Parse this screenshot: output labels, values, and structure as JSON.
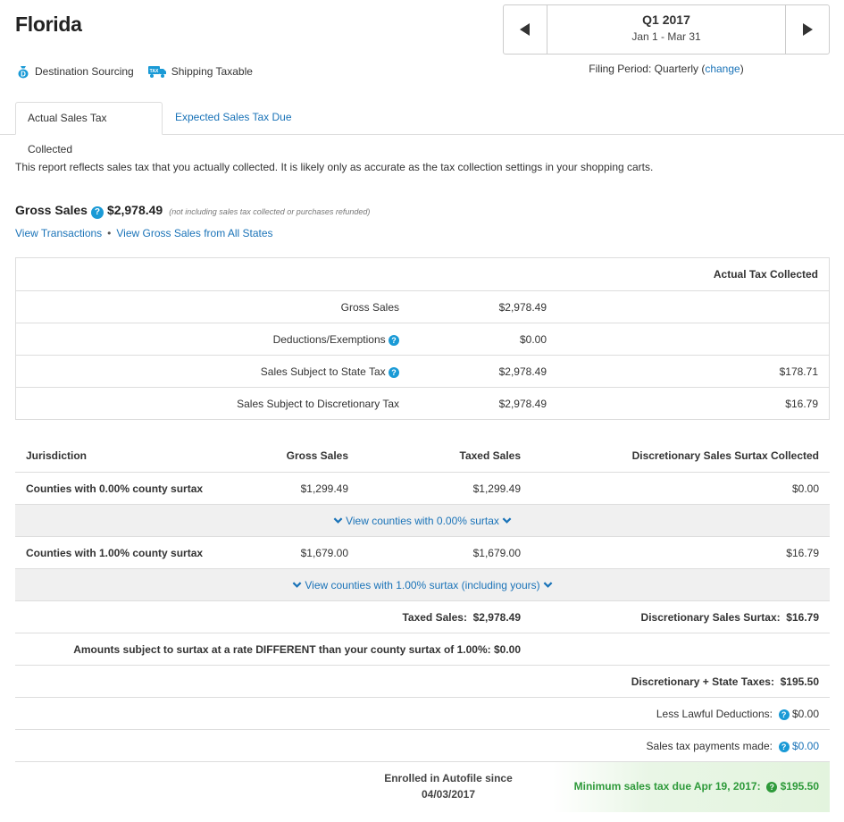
{
  "header": {
    "state": "Florida",
    "badges": [
      {
        "icon": "money-bag-icon",
        "label": "Destination Sourcing"
      },
      {
        "icon": "tax-truck-icon",
        "label": "Shipping Taxable"
      }
    ]
  },
  "period": {
    "quarter": "Q1 2017",
    "dates": "Jan 1 - Mar 31",
    "filing_prefix": "Filing Period: Quarterly (",
    "filing_change": "change",
    "filing_suffix": ")"
  },
  "tabs": [
    {
      "label": "Actual Sales Tax Collected",
      "active": true
    },
    {
      "label": "Expected Sales Tax Due",
      "active": false
    }
  ],
  "intro": "This report reflects sales tax that you actually collected. It is likely only as accurate as the tax collection settings in your shopping carts.",
  "gross": {
    "label": "Gross Sales",
    "value": "$2,978.49",
    "note": "(not including sales tax collected or purchases refunded)",
    "link1": "View Transactions",
    "separator": "•",
    "link2": "View Gross Sales from All States"
  },
  "summary_table": {
    "header": "Actual Tax Collected",
    "rows": [
      {
        "label": "Gross Sales",
        "amount": "$2,978.49",
        "tax": ""
      },
      {
        "label": "Deductions/Exemptions",
        "amount": "$0.00",
        "tax": "",
        "help": true
      },
      {
        "label": "Sales Subject to State Tax",
        "amount": "$2,978.49",
        "tax": "$178.71",
        "help": true
      },
      {
        "label": "Sales Subject to Discretionary Tax",
        "amount": "$2,978.49",
        "tax": "$16.79"
      }
    ]
  },
  "jurisdiction_table": {
    "headers": {
      "jurisdiction": "Jurisdiction",
      "gross": "Gross Sales",
      "taxed": "Taxed Sales",
      "surtax": "Discretionary Sales Surtax Collected"
    },
    "groups": [
      {
        "name": "Counties with 0.00% county surtax",
        "gross": "$1,299.49",
        "taxed": "$1,299.49",
        "surtax": "$0.00",
        "expand": "View counties with 0.00% surtax"
      },
      {
        "name": "Counties with 1.00% county surtax",
        "gross": "$1,679.00",
        "taxed": "$1,679.00",
        "surtax": "$16.79",
        "expand": "View counties with 1.00% surtax (including yours)"
      }
    ],
    "totals": {
      "taxed_label": "Taxed Sales:",
      "taxed_value": "$2,978.49",
      "surtax_label": "Discretionary Sales Surtax:",
      "surtax_value": "$16.79"
    },
    "different_rate": "Amounts subject to surtax at a rate DIFFERENT than your county surtax of 1.00%: $0.00",
    "combined_label": "Discretionary + State Taxes:",
    "combined_value": "$195.50",
    "deductions_label": "Less Lawful Deductions:",
    "deductions_value": "$0.00",
    "payments_label": "Sales tax payments made:",
    "payments_value": "$0.00",
    "autofile_line1": "Enrolled in Autofile since",
    "autofile_line2": "04/03/2017",
    "min_due_label": "Minimum sales tax due Apr 19, 2017:",
    "min_due_value": "$195.50"
  },
  "colors": {
    "link": "#1a73b8",
    "help_icon": "#1a9ad6",
    "due_green": "#2e9a3a"
  }
}
